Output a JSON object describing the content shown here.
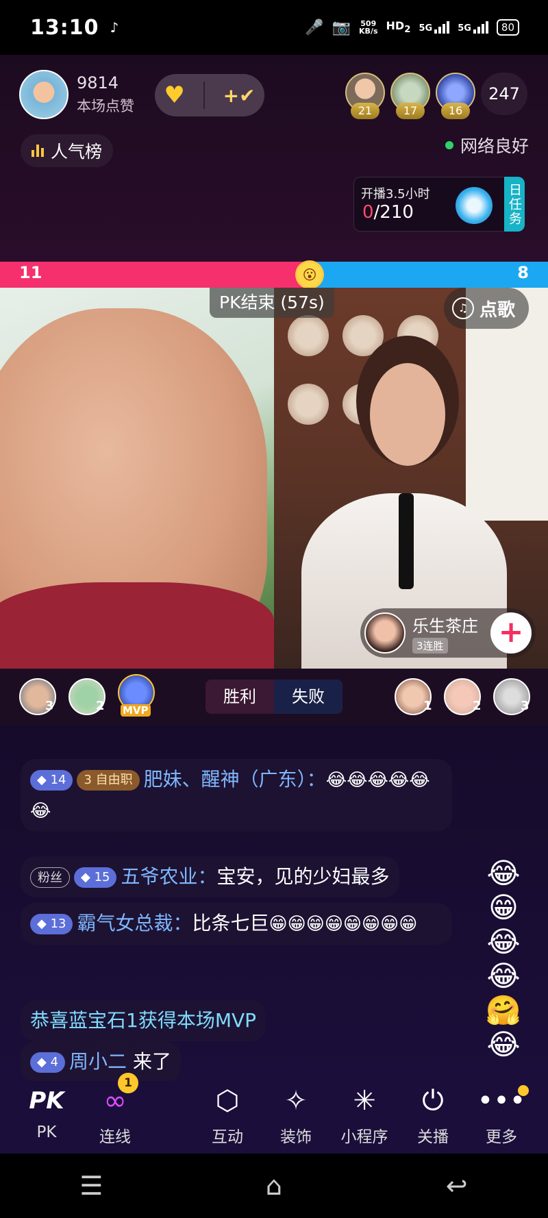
{
  "status_bar": {
    "time": "13:10",
    "net_speed_value": "509",
    "net_speed_unit": "KB/s",
    "hd_label": "HD",
    "hd_sub": "2",
    "sig1_label": "5G",
    "sig2_label": "5G",
    "battery": "80"
  },
  "host": {
    "likes": "9814",
    "likes_label": "本场点赞"
  },
  "viewers": {
    "top": [
      {
        "rank": "21"
      },
      {
        "rank": "17"
      },
      {
        "rank": "16"
      }
    ],
    "count": "247"
  },
  "rank_button": "人气榜",
  "network_status": "网络良好",
  "task": {
    "title": "开播3.5小时",
    "current": "0",
    "total": "/210",
    "side_label": "日任务"
  },
  "pk": {
    "left_score": "11",
    "right_score": "8",
    "left_share": 0.565,
    "end_label": "PK结束 (57s)",
    "song_label": "点歌"
  },
  "opponent": {
    "name": "乐生茶庄",
    "streak": "3连胜"
  },
  "calligraphy_text": "",
  "result": {
    "win_label": "胜利",
    "lose_label": "失败",
    "left_contrib_ranks": [
      "3",
      "2",
      "MVP"
    ],
    "right_contrib_ranks": [
      "1",
      "2",
      "3"
    ]
  },
  "chat": [
    {
      "level": "14",
      "job_level": "3",
      "job": "自由职",
      "user": "肥妹、醒神（广东）：",
      "text": "",
      "emojis": "😂😂😂😂😂😂"
    },
    {
      "fans_label": "粉丝",
      "level": "15",
      "user": "五爷农业：",
      "text": "宝安，见的少妇最多"
    },
    {
      "level": "13",
      "user": "霸气女总裁：",
      "text": "比条七巨",
      "emojis": "😁😁😁😁😁😁😁😁"
    },
    {
      "system": "恭喜蓝宝石1获得本场MVP"
    },
    {
      "level": "4",
      "user": "周小二",
      "text": " 来了"
    }
  ],
  "float_emojis": "😂😁😂😂🤗😂",
  "bottom_nav": [
    {
      "label": "PK",
      "icon": "pk-icon"
    },
    {
      "label": "连线",
      "icon": "link-icon",
      "badge": "1"
    },
    {
      "label": "互动",
      "icon": "interact-icon"
    },
    {
      "label": "装饰",
      "icon": "decorate-icon"
    },
    {
      "label": "小程序",
      "icon": "mini-program-icon"
    },
    {
      "label": "关播",
      "icon": "power-icon"
    },
    {
      "label": "更多",
      "icon": "more-icon"
    }
  ],
  "colors": {
    "pk_red": "#f62f6d",
    "pk_blue": "#1ca7f2",
    "accent_gold": "#ffc72c"
  }
}
